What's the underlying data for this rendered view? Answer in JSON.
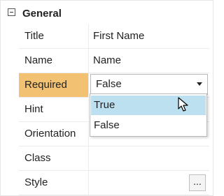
{
  "section": {
    "title": "General",
    "icon": "collapse-minus-icon"
  },
  "rows": [
    {
      "label": "Title",
      "value": "First Name"
    },
    {
      "label": "Name",
      "value": "Name"
    },
    {
      "label": "Required",
      "value": "False"
    },
    {
      "label": "Hint",
      "value": ""
    },
    {
      "label": "Orientation",
      "value": ""
    },
    {
      "label": "Class",
      "value": ""
    },
    {
      "label": "Style",
      "value": ""
    }
  ],
  "dropdown": {
    "options": [
      "True",
      "False"
    ],
    "highlighted": "True"
  },
  "style_button": {
    "label": "..."
  },
  "colors": {
    "selected_label_bg": "#f3c172",
    "highlighted_option_bg": "#bde0f0"
  },
  "icons": {
    "dropdown_arrow": "dropdown-arrow-icon",
    "cursor": "mouse-cursor-icon"
  }
}
